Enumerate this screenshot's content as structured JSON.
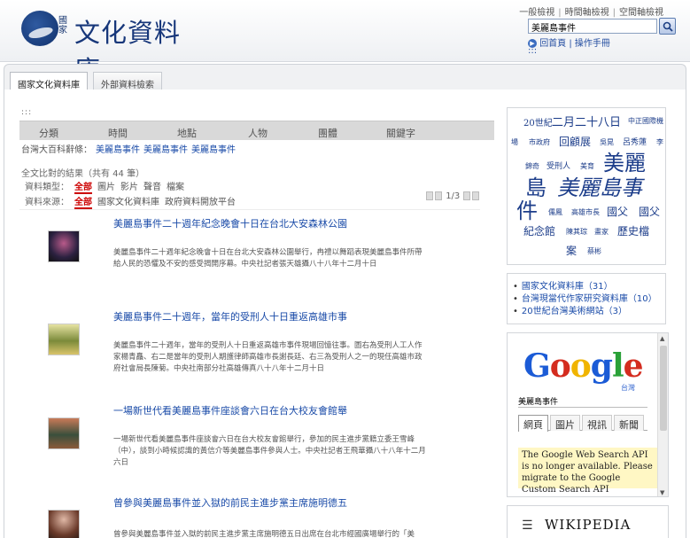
{
  "header": {
    "logo_small": "國家",
    "logo_text": "文化資料庫",
    "top_links": [
      "一般檢視",
      "時間軸檢視",
      "空間軸檢視"
    ],
    "search_value": "美麗島事件",
    "home_link": "回首頁",
    "help_link": "操作手冊",
    "sub_dots": ":::"
  },
  "tabs": [
    "國家文化資料庫",
    "外部資料檢索"
  ],
  "main": {
    "dots": ":::",
    "facets": [
      "分類",
      "時間",
      "地點",
      "人物",
      "團體",
      "關鍵字"
    ],
    "related_label": "台灣大百科辭條：",
    "related_links": [
      "美麗島事件",
      "美麗島事件",
      "美麗島事件"
    ],
    "results_summary": "全文比對的結果（共有 44 筆）",
    "type_label": "資料類型：",
    "type_selected": "全部",
    "type_options": [
      "圖片",
      "影片",
      "聲音",
      "檔案"
    ],
    "source_label": "資料來源：",
    "source_selected": "全部",
    "source_options": [
      "國家文化資料庫",
      "政府資料開放平台"
    ],
    "pager": "1/3",
    "results": [
      {
        "title": "美麗島事件二十週年紀念晚會十日在台北大安森林公園",
        "desc": "美麗島事件二十週年紀念晚會十日在台北大安森林公園舉行，冉禮以舞蹈表現美麗島事件所帶給人民的恐懼及不安的感受揭開序幕。中央社記者張天雄攝八十八年十二月十日"
      },
      {
        "title": "美麗島事件二十週年，當年的受刑人十日重返高雄市事",
        "desc": "美麗島事件二十週年，當年的受刑人十日重返高雄市事件現場回憶往事。圖右為受刑人工人作家楊青矗、右二是當年的受刑人期護律師高雄市長謝長廷、右三為受刑人之一的現任高雄市政府社會局長陳菊。中央社南部分社高雄傳真八十八年十二月十日"
      },
      {
        "title": "一場新世代看美麗島事件座談會六日在台大校友會館舉",
        "desc": "一場新世代看美麗島事件座談會六日在台大校友會館舉行，參加的民主進步黨籍立委王雪峰（中），談到小時候認識的黃信介等美麗島事件參與人士。中央社記者王飛華攝八十八年十二月六日"
      },
      {
        "title": "曾參與美麗島事件並入獄的前民主進步黨主席施明德五",
        "desc": "曾參與美麗島事件並入獄的前民主進步黨主席施明德五日出席在台北市經國廣場舉行的「美"
      }
    ]
  },
  "sidebar": {
    "cloud": [
      {
        "text": "20世紀",
        "size": 10
      },
      {
        "text": "二月二十八日",
        "size": 13
      },
      {
        "text": "中正國際機",
        "size": 8
      },
      {
        "text": "場",
        "size": 8
      },
      {
        "text": "市政府",
        "size": 8
      },
      {
        "text": "回顧展",
        "size": 12
      },
      {
        "text": "吳晃",
        "size": 8
      },
      {
        "text": "呂秀蓮",
        "size": 9
      },
      {
        "text": "李",
        "size": 8
      },
      {
        "text": "錦奇",
        "size": 8
      },
      {
        "text": "受刑人",
        "size": 9
      },
      {
        "text": "美育",
        "size": 8
      },
      {
        "text": "美麗",
        "size": 24
      },
      {
        "text": "島",
        "size": 24
      },
      {
        "text": "美麗島事",
        "size": 24
      },
      {
        "text": "件",
        "size": 24
      },
      {
        "text": "儒鳳",
        "size": 8
      },
      {
        "text": "高雄市長",
        "size": 8
      },
      {
        "text": "國父",
        "size": 12
      },
      {
        "text": "國父",
        "size": 12
      },
      {
        "text": "紀念館",
        "size": 12
      },
      {
        "text": "陳其琮",
        "size": 8
      },
      {
        "text": "畫家",
        "size": 8
      },
      {
        "text": "歷史檔",
        "size": 12
      },
      {
        "text": "案",
        "size": 12
      },
      {
        "text": "蔡彬",
        "size": 8
      }
    ],
    "links": [
      "國家文化資料庫（31）",
      "台灣現當代作家研究資料庫（10）",
      "20世紀台灣美術網站（3）"
    ],
    "google_sub": "台灣",
    "google_query": "美麗島事件",
    "google_tabs": [
      "網頁",
      "圖片",
      "視訊",
      "新聞"
    ],
    "google_notice": "The Google Web Search API is no longer available. Please migrate to the Google Custom Search API",
    "wiki_title": "WIKIPEDIA"
  },
  "colors": {
    "link": "#1a4ba8",
    "selected": "#cc0000",
    "cloud": "#1c3d8a"
  }
}
